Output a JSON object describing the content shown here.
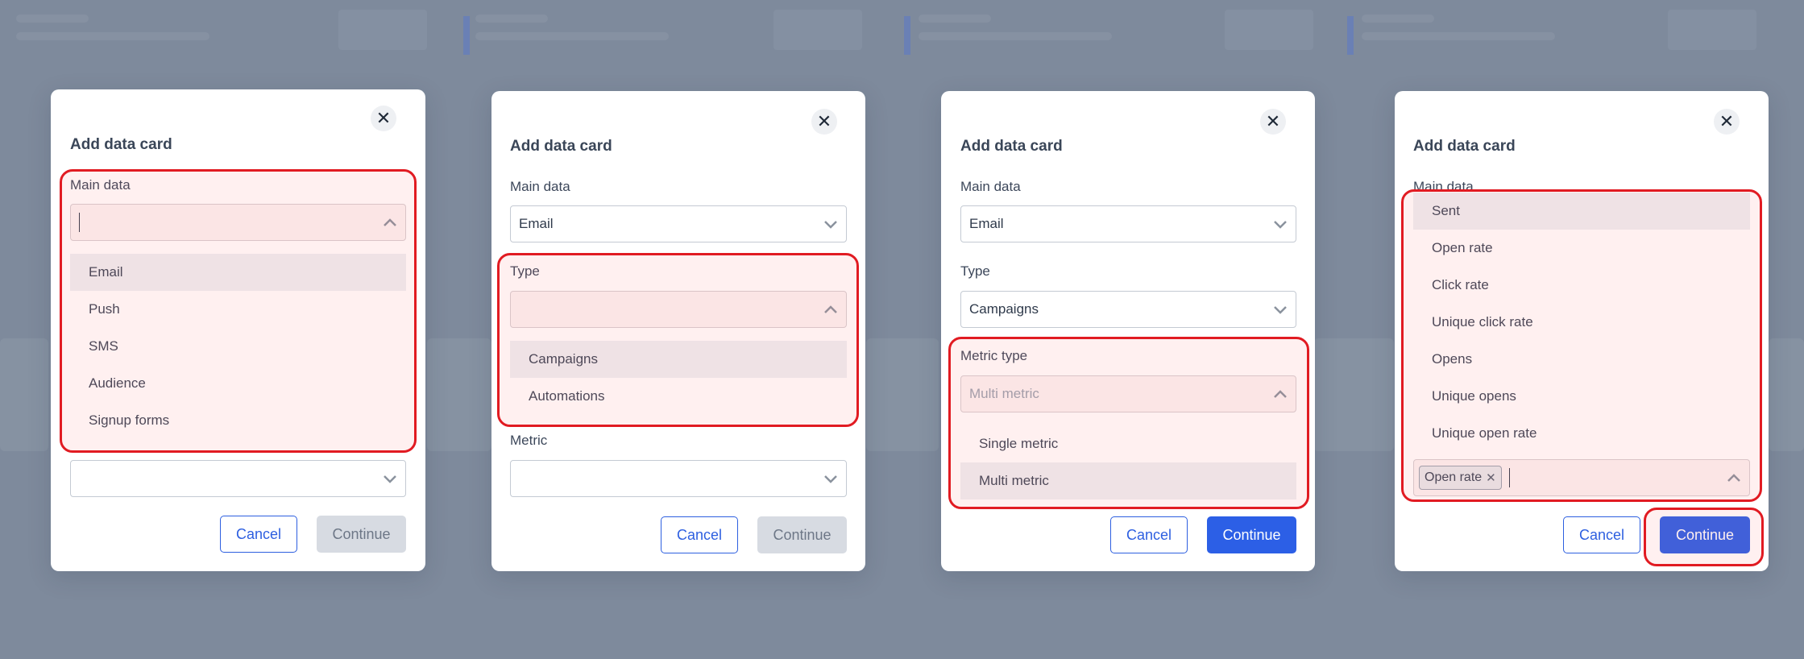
{
  "panels": [
    {
      "title": "Add data card",
      "main_label": "Main data",
      "main_options": [
        "Email",
        "Push",
        "SMS",
        "Audience",
        "Signup forms"
      ],
      "cancel": "Cancel",
      "continue": "Continue"
    },
    {
      "title": "Add data card",
      "main_label": "Main data",
      "main_value": "Email",
      "type_label": "Type",
      "type_options": [
        "Campaigns",
        "Automations"
      ],
      "metric_label": "Metric",
      "cancel": "Cancel",
      "continue": "Continue"
    },
    {
      "title": "Add data card",
      "main_label": "Main data",
      "main_value": "Email",
      "type_label": "Type",
      "type_value": "Campaigns",
      "metric_type_label": "Metric type",
      "metric_type_value": "Multi metric",
      "metric_type_options": [
        "Single metric",
        "Multi metric"
      ],
      "cancel": "Cancel",
      "continue": "Continue"
    },
    {
      "title": "Add data card",
      "main_label": "Main data",
      "metric_options": [
        "Sent",
        "Open rate",
        "Click rate",
        "Unique click rate",
        "Opens",
        "Unique opens",
        "Unique open rate"
      ],
      "selected_tag": "Open rate",
      "cancel": "Cancel",
      "continue": "Continue"
    }
  ],
  "icons": {
    "close": "close-icon",
    "chevron_down": "chevron-down-icon",
    "chevron_up": "chevron-up-icon",
    "tag_remove": "remove-tag-icon"
  },
  "colors": {
    "primary": "#2c5fe6",
    "highlight": "#e11b22",
    "backdrop": "#7e8a9c"
  }
}
